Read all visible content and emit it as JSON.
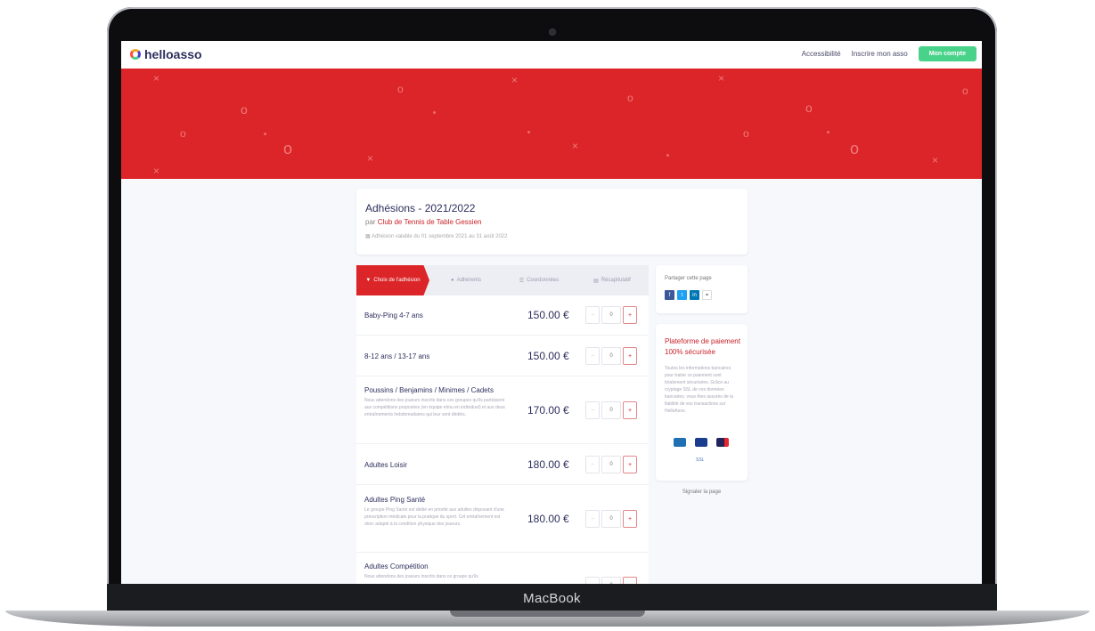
{
  "device": {
    "brand": "MacBook"
  },
  "topbar": {
    "logo": "helloasso",
    "nav": [
      "Accessibilité",
      "Inscrire mon asso"
    ],
    "account_button": "Mon compte"
  },
  "header": {
    "title": "Adhésions - 2021/2022",
    "by": "par",
    "org": "Club de Tennis de Table Gessien",
    "dates": "Adhésion valable du 01 septembre 2021 au 31 août 2022"
  },
  "tabs": [
    {
      "label": "Choix de l'adhésion",
      "icon": "tag-icon",
      "active": true
    },
    {
      "label": "Adhérents",
      "icon": "user-icon",
      "active": false
    },
    {
      "label": "Coordonnées",
      "icon": "list-icon",
      "active": false
    },
    {
      "label": "Récapitulatif",
      "icon": "doc-icon",
      "active": false
    }
  ],
  "items": [
    {
      "name": "Baby-Ping 4-7 ans",
      "desc": "",
      "price": "150.00 €",
      "qty": "0"
    },
    {
      "name": "8-12 ans / 13-17 ans",
      "desc": "",
      "price": "150.00 €",
      "qty": "0"
    },
    {
      "name": "Poussins / Benjamins / Minimes / Cadets",
      "desc": "Nous attendons des joueurs inscrits dans ces groupes qu'ils participent aux compétitions proposées (en équipe et/ou en individuel) et aux deux entraînements hebdomadaires qui leur sont dédiés.",
      "price": "170.00 €",
      "qty": "0"
    },
    {
      "name": "Adultes Loisir",
      "desc": "",
      "price": "180.00 €",
      "qty": "0"
    },
    {
      "name": "Adultes Ping Santé",
      "desc": "Le groupe Ping Santé est dédié en priorité aux adultes disposant d'une prescription médicale pour la pratique du sport. Cet entraînement est donc adapté à la condition physique des joueurs.",
      "price": "180.00 €",
      "qty": "0"
    },
    {
      "name": "Adultes Compétition",
      "desc": "Nous attendons des joueurs inscrits dans ce groupe qu'ils",
      "price": "",
      "qty": "0"
    }
  ],
  "stepper": {
    "minus": "−",
    "plus": "+"
  },
  "share": {
    "label": "Partager cette page",
    "icons": [
      {
        "icon": "facebook-icon",
        "glyph": "f",
        "color": "#3b5998"
      },
      {
        "icon": "twitter-icon",
        "glyph": "t",
        "color": "#1da1f2"
      },
      {
        "icon": "linkedin-icon",
        "glyph": "in",
        "color": "#0077b5"
      },
      {
        "icon": "link-icon",
        "glyph": "⚭",
        "color": "#ffffff"
      }
    ]
  },
  "payment": {
    "title": "Plateforme de paiement 100% sécurisée",
    "desc": "Toutes les informations bancaires pour traiter ce paiement sont totalement sécurisées. Grâce au cryptage SSL de vos données bancaires, vous êtes assurés de la fiabilité de vos transactions sur HelloAsso.",
    "ssl": "SSL"
  },
  "report": "Signaler la page"
}
